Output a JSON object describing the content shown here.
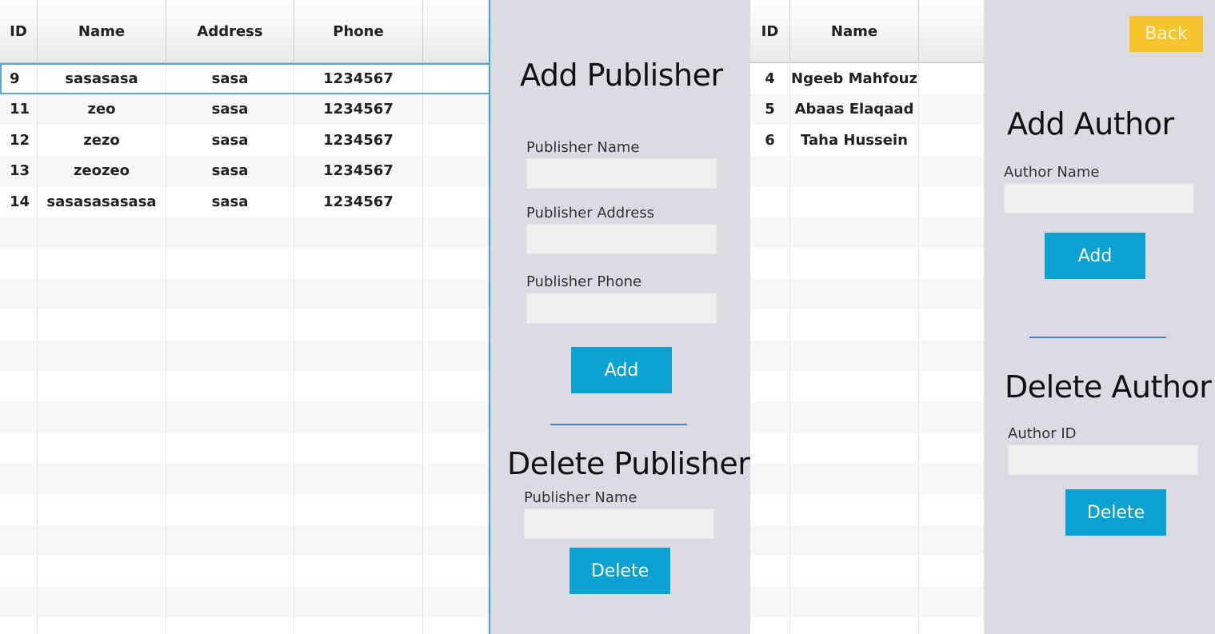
{
  "publishers_table": {
    "columns": [
      "ID",
      "Name",
      "Address",
      "Phone",
      ""
    ],
    "rows": [
      {
        "id": "9",
        "name": "sasasasa",
        "address": "sasa",
        "phone": "1234567"
      },
      {
        "id": "11",
        "name": "zeo",
        "address": "sasa",
        "phone": "1234567"
      },
      {
        "id": "12",
        "name": "zezo",
        "address": "sasa",
        "phone": "1234567"
      },
      {
        "id": "13",
        "name": "zeozeo",
        "address": "sasa",
        "phone": "1234567"
      },
      {
        "id": "14",
        "name": "sasasasasasa",
        "address": "sasa",
        "phone": "1234567"
      }
    ],
    "selected_row_id": "9"
  },
  "publisher_form": {
    "add_title": "Add Publisher",
    "name_label": "Publisher Name",
    "name_value": "",
    "address_label": "Publisher Address",
    "address_value": "",
    "phone_label": "Publisher Phone",
    "phone_value": "",
    "add_button": "Add",
    "delete_title": "Delete Publisher",
    "delete_name_label": "Publisher Name",
    "delete_name_value": "",
    "delete_button": "Delete"
  },
  "authors_table": {
    "columns": [
      "ID",
      "Name",
      ""
    ],
    "rows": [
      {
        "id": "4",
        "name": "Ngeeb Mahfouz"
      },
      {
        "id": "5",
        "name": "Abaas Elaqaad"
      },
      {
        "id": "6",
        "name": "Taha Hussein"
      }
    ]
  },
  "author_form": {
    "back_button": "Back",
    "add_title": "Add Author",
    "name_label": "Author Name",
    "name_value": "",
    "add_button": "Add",
    "delete_title": "Delete Author",
    "id_label": "Author ID",
    "id_value": "",
    "delete_button": "Delete"
  },
  "colors": {
    "accent_button": "#0aa2d3",
    "back_button": "#f8c42d",
    "panel_background": "#dcdae3",
    "divider": "#4b86c8",
    "selection_outline": "#5aa8d6"
  }
}
